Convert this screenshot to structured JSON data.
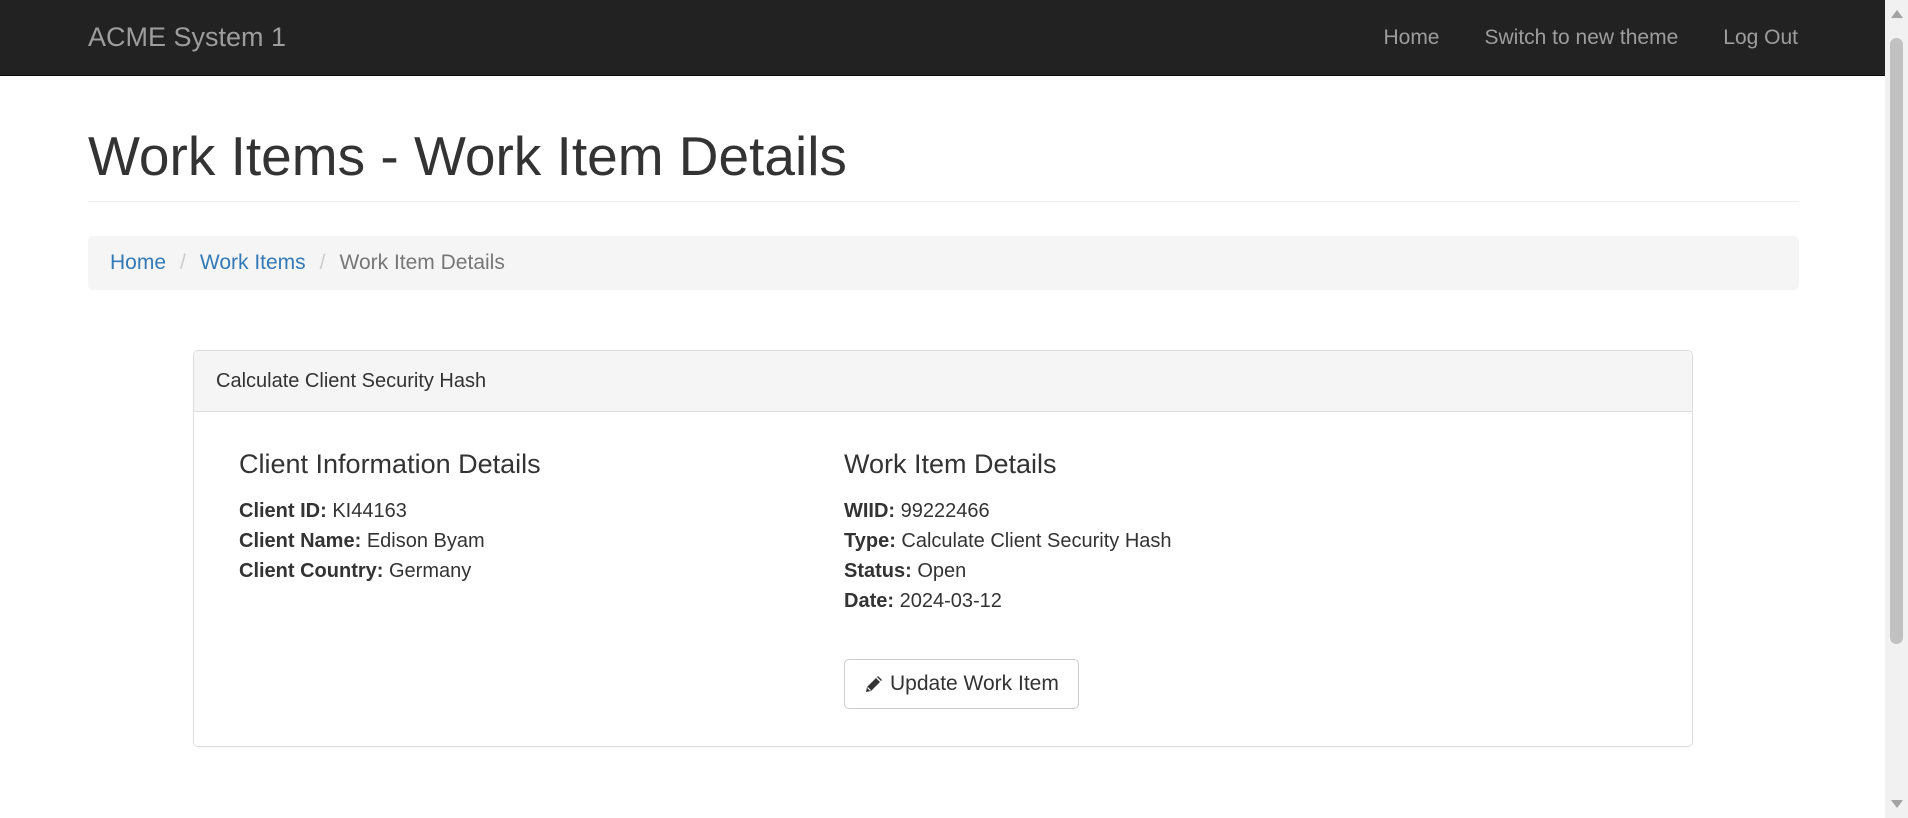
{
  "navbar": {
    "brand": "ACME System 1",
    "links": [
      "Home",
      "Switch to new theme",
      "Log Out"
    ]
  },
  "page": {
    "title": "Work Items - Work Item Details"
  },
  "breadcrumb": {
    "items": [
      "Home",
      "Work Items"
    ],
    "active": "Work Item Details",
    "separator": "/"
  },
  "panel": {
    "heading": "Calculate Client Security Hash",
    "client": {
      "title": "Client Information Details",
      "fields": [
        {
          "label": "Client ID:",
          "value": "KI44163"
        },
        {
          "label": "Client Name:",
          "value": "Edison Byam"
        },
        {
          "label": "Client Country:",
          "value": "Germany"
        }
      ]
    },
    "work_item": {
      "title": "Work Item Details",
      "fields": [
        {
          "label": "WIID:",
          "value": "99222466"
        },
        {
          "label": "Type:",
          "value": "Calculate Client Security Hash"
        },
        {
          "label": "Status:",
          "value": "Open"
        },
        {
          "label": "Date:",
          "value": "2024-03-12"
        }
      ]
    },
    "update_button": {
      "label": "Update Work Item",
      "icon": "pencil-icon"
    }
  },
  "colors": {
    "navbar_bg": "#222222",
    "link": "#337ab7",
    "muted": "#9d9d9d"
  }
}
